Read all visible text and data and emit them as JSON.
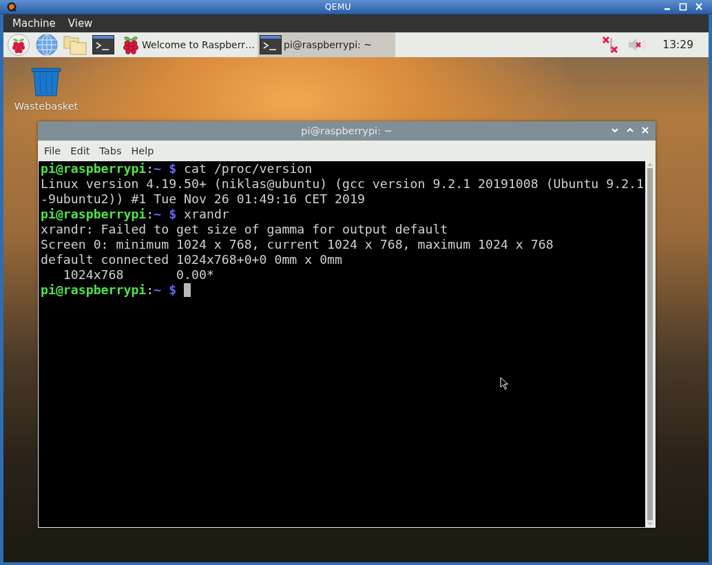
{
  "window": {
    "title": "QEMU"
  },
  "menu": [
    "Machine",
    "View"
  ],
  "taskbar": [
    {
      "kind": "raspberry",
      "label": "Welcome to Raspberr…",
      "selected": false
    },
    {
      "kind": "terminal",
      "label": "pi@raspberrypi: ~",
      "selected": true
    }
  ],
  "tray": {
    "network_connected": false,
    "muted": true,
    "clock": "13:29"
  },
  "desktop_icons": [
    {
      "label": "Wastebasket"
    }
  ],
  "terminal": {
    "title": "pi@raspberrypi: ~",
    "menu": [
      "File",
      "Edit",
      "Tabs",
      "Help"
    ],
    "lines": [
      {
        "kind": "prompt",
        "user_host": "pi@raspberrypi",
        "colon": ":",
        "cwd": "~ $",
        "command": "cat /proc/version",
        "cursor": false
      },
      {
        "kind": "output",
        "text": "Linux version 4.19.50+ (niklas@ubuntu) (gcc version 9.2.1 20191008 (Ubuntu 9.2.1"
      },
      {
        "kind": "output",
        "text": "-9ubuntu2)) #1 Tue Nov 26 01:49:16 CET 2019"
      },
      {
        "kind": "prompt",
        "user_host": "pi@raspberrypi",
        "colon": ":",
        "cwd": "~ $",
        "command": "xrandr",
        "cursor": false
      },
      {
        "kind": "output",
        "text": "xrandr: Failed to get size of gamma for output default"
      },
      {
        "kind": "output",
        "text": "Screen 0: minimum 1024 x 768, current 1024 x 768, maximum 1024 x 768"
      },
      {
        "kind": "output",
        "text": "default connected 1024x768+0+0 0mm x 0mm"
      },
      {
        "kind": "output",
        "text": "   1024x768       0.00*"
      },
      {
        "kind": "prompt",
        "user_host": "pi@raspberrypi",
        "colon": ":",
        "cwd": "~ $",
        "cursor": true
      }
    ]
  }
}
